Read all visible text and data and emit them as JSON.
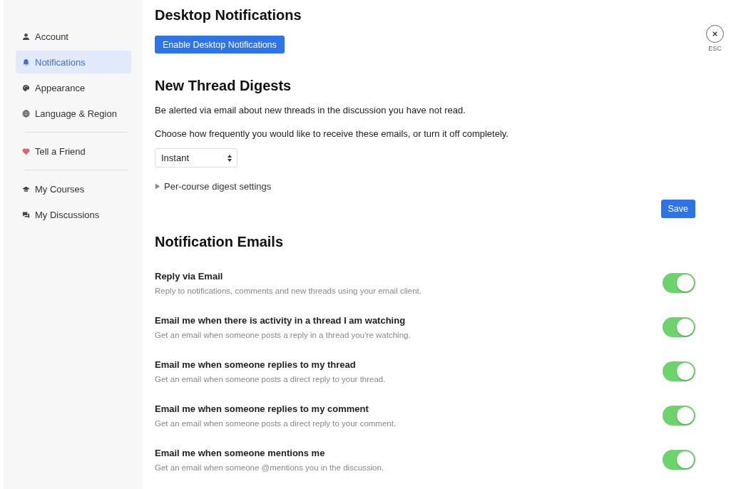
{
  "sidebar": {
    "groups": [
      {
        "items": [
          {
            "label": "Account",
            "selected": false
          },
          {
            "label": "Notifications",
            "selected": true
          },
          {
            "label": "Appearance",
            "selected": false
          },
          {
            "label": "Language & Region",
            "selected": false
          }
        ]
      },
      {
        "items": [
          {
            "label": "Tell a Friend",
            "selected": false
          }
        ]
      },
      {
        "items": [
          {
            "label": "My Courses",
            "selected": false
          },
          {
            "label": "My Discussions",
            "selected": false
          }
        ]
      }
    ]
  },
  "close": {
    "label": "ESC"
  },
  "desktop_notifications": {
    "title": "Desktop Notifications",
    "button": "Enable Desktop Notifications"
  },
  "digests": {
    "title": "New Thread Digests",
    "description": "Be alerted via email about new threads in the discussion you have not read.",
    "hint": "Choose how frequently you would like to receive these emails, or turn it off completely.",
    "frequency": "Instant",
    "per_course": {
      "label": "Per-course digest settings",
      "expanded": false
    },
    "save": "Save"
  },
  "emails": {
    "title": "Notification Emails",
    "settings": [
      {
        "title": "Reply via Email",
        "description": "Reply to notifications, comments and new threads using your email client.",
        "on": true
      },
      {
        "title": "Email me when there is activity in a thread I am watching",
        "description": "Get an email when someone posts a reply in a thread you’re watching.",
        "on": true
      },
      {
        "title": "Email me when someone replies to my thread",
        "description": "Get an email when someone posts a direct reply to your thread.",
        "on": true
      },
      {
        "title": "Email me when someone replies to my comment",
        "description": "Get an email when someone posts a direct reply to your comment.",
        "on": true
      },
      {
        "title": "Email me when someone mentions me",
        "description": "Get an email when someone @mentions you in the discussion.",
        "on": true
      }
    ]
  }
}
